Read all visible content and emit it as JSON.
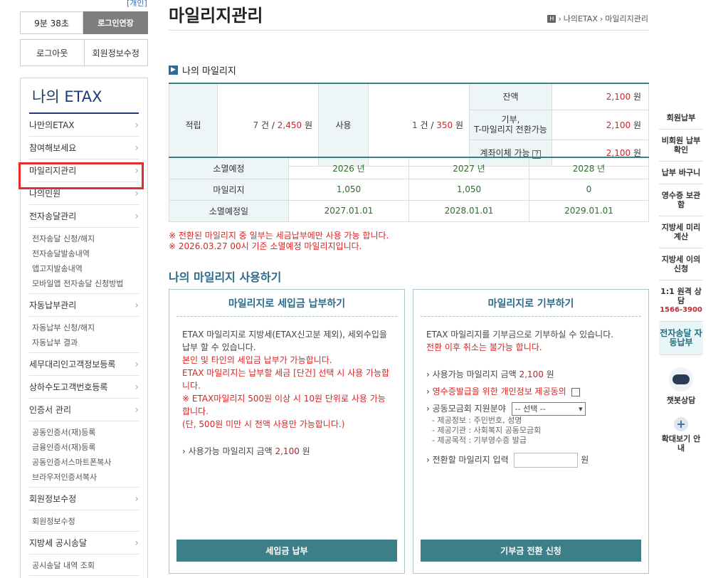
{
  "header": {
    "top_link": "[개인]",
    "timer": "9분 38초",
    "extend_label": "로그인연장",
    "logout_label": "로그아웃",
    "profile_edit_label": "회원정보수정"
  },
  "sidebar": {
    "title": "나의 ETAX",
    "items": [
      {
        "label": "나만의ETAX"
      },
      {
        "label": "참여해보세요"
      },
      {
        "label": "마일리지관리"
      },
      {
        "label": "나의민원"
      },
      {
        "label": "전자송달관리"
      }
    ],
    "sub1": [
      "전자송달 신청/해지",
      "전자송달발송내역",
      "앱고지발송내역",
      "모바일앱 전자송달 신청방법"
    ],
    "item_auto": "자동납부관리",
    "sub2": [
      "자동납부 신청/해지",
      "자동납부 결과"
    ],
    "items2": [
      {
        "label": "세무대리인고객정보등록"
      },
      {
        "label": "상하수도고객번호등록"
      },
      {
        "label": "인증서 관리"
      }
    ],
    "sub3": [
      "공동인증서(재)등록",
      "금융인증서(재)등록",
      "공동인증서스마트폰복사",
      "브라우저인증서복사"
    ],
    "item_member": "회원정보수정",
    "sub4": [
      "회원정보수정"
    ],
    "item_notice": "지방세 공시송달",
    "sub5": [
      "공시송달 내역 조회"
    ]
  },
  "page": {
    "title": "마일리지관리",
    "breadcrumb_home": "H",
    "breadcrumb": [
      "나의ETAX",
      "마일리지관리"
    ]
  },
  "mileage": {
    "section_title": "나의 마일리지",
    "earn_label": "적립",
    "earn_count": "7",
    "earn_amount": "2,450",
    "use_label": "사용",
    "use_count": "1",
    "use_amount": "350",
    "unit_count": "건",
    "unit_won": "원",
    "sep": "/",
    "balance_label": "잔액",
    "balance": "2,100",
    "donate_label_1": "기부,",
    "donate_label_2": "T-마일리지 전환가능",
    "donate_amount": "2,100",
    "transfer_label": "계좌이체 가능",
    "transfer_help": "?",
    "transfer_amount": "2,100"
  },
  "expire": {
    "row_year_label": "소멸예정",
    "years": [
      "2026 년",
      "2027 년",
      "2028 년"
    ],
    "row_mileage_label": "마일리지",
    "amounts": [
      "1,050",
      "1,050",
      "0"
    ],
    "row_date_label": "소멸예정일",
    "dates": [
      "2027.01.01",
      "2028.01.01",
      "2029.01.01"
    ]
  },
  "notes": [
    "※ 전환된 마일리지 중 일부는 세금납부에만 사용 가능 합니다.",
    "※ 2026.03.27 00시 기준 소멸예정 마일리지입니다."
  ],
  "use_section": {
    "title": "나의 마일리지 사용하기",
    "tax": {
      "title": "마일리지로 세입금 납부하기",
      "p1": "ETAX 마일리지로 지방세(ETAX신고분 제외), 세외수입을 납부 할 수 있습니다.",
      "p2": "본인 및 타인의 세입금 납부가 가능합니다.",
      "p3": "ETAX 마일리지는 납부할 세금 [단건] 선택 시 사용 가능합니다.",
      "p4": "※ ETAX마일리지 500원 이상 시 10원 단위로 사용 가능합니다.",
      "p5": "(단, 500원 미만 시 전액 사용만 가능합니다.)",
      "avail_label": "사용가능 마일리지 금액",
      "avail_amount": "2,100",
      "unit": "원",
      "button": "세입금 납부"
    },
    "donate": {
      "title": "마일리지로 기부하기",
      "p1": "ETAX 마일리지를 기부금으로 기부하실 수 있습니다.",
      "p2": "전환 이후 취소는 불가능 합니다.",
      "avail_label": "사용가능 마일리지 금액",
      "avail_amount": "2,100",
      "unit": "원",
      "consent_label": "영수증발급을 위한 개인정보 제공동의",
      "field_label": "공동모금회 지원분야",
      "field_select": "-- 선택 --",
      "info1": "- 제공정보 : 주민번호, 성명",
      "info2": "- 제공기관 : 사회복지 공동모금회",
      "info3": "- 제공목적 : 기부영수증 발급",
      "convert_label": "전환할 마일리지 입력",
      "convert_unit": "원",
      "button": "기부금 전환 신청"
    }
  },
  "quick_menu": {
    "items": [
      "회원납부",
      "비회원 납부확인",
      "납부 바구니",
      "영수증 보관함",
      "지방세 미리계산",
      "지방세 이의신청"
    ],
    "consult_label": "1:1 원격 상담",
    "consult_phone": "1566-3900",
    "ebill_label": "전자송달 자동납부",
    "chatbot_label": "챗봇상담",
    "zoom_label": "확대보기 안내"
  }
}
